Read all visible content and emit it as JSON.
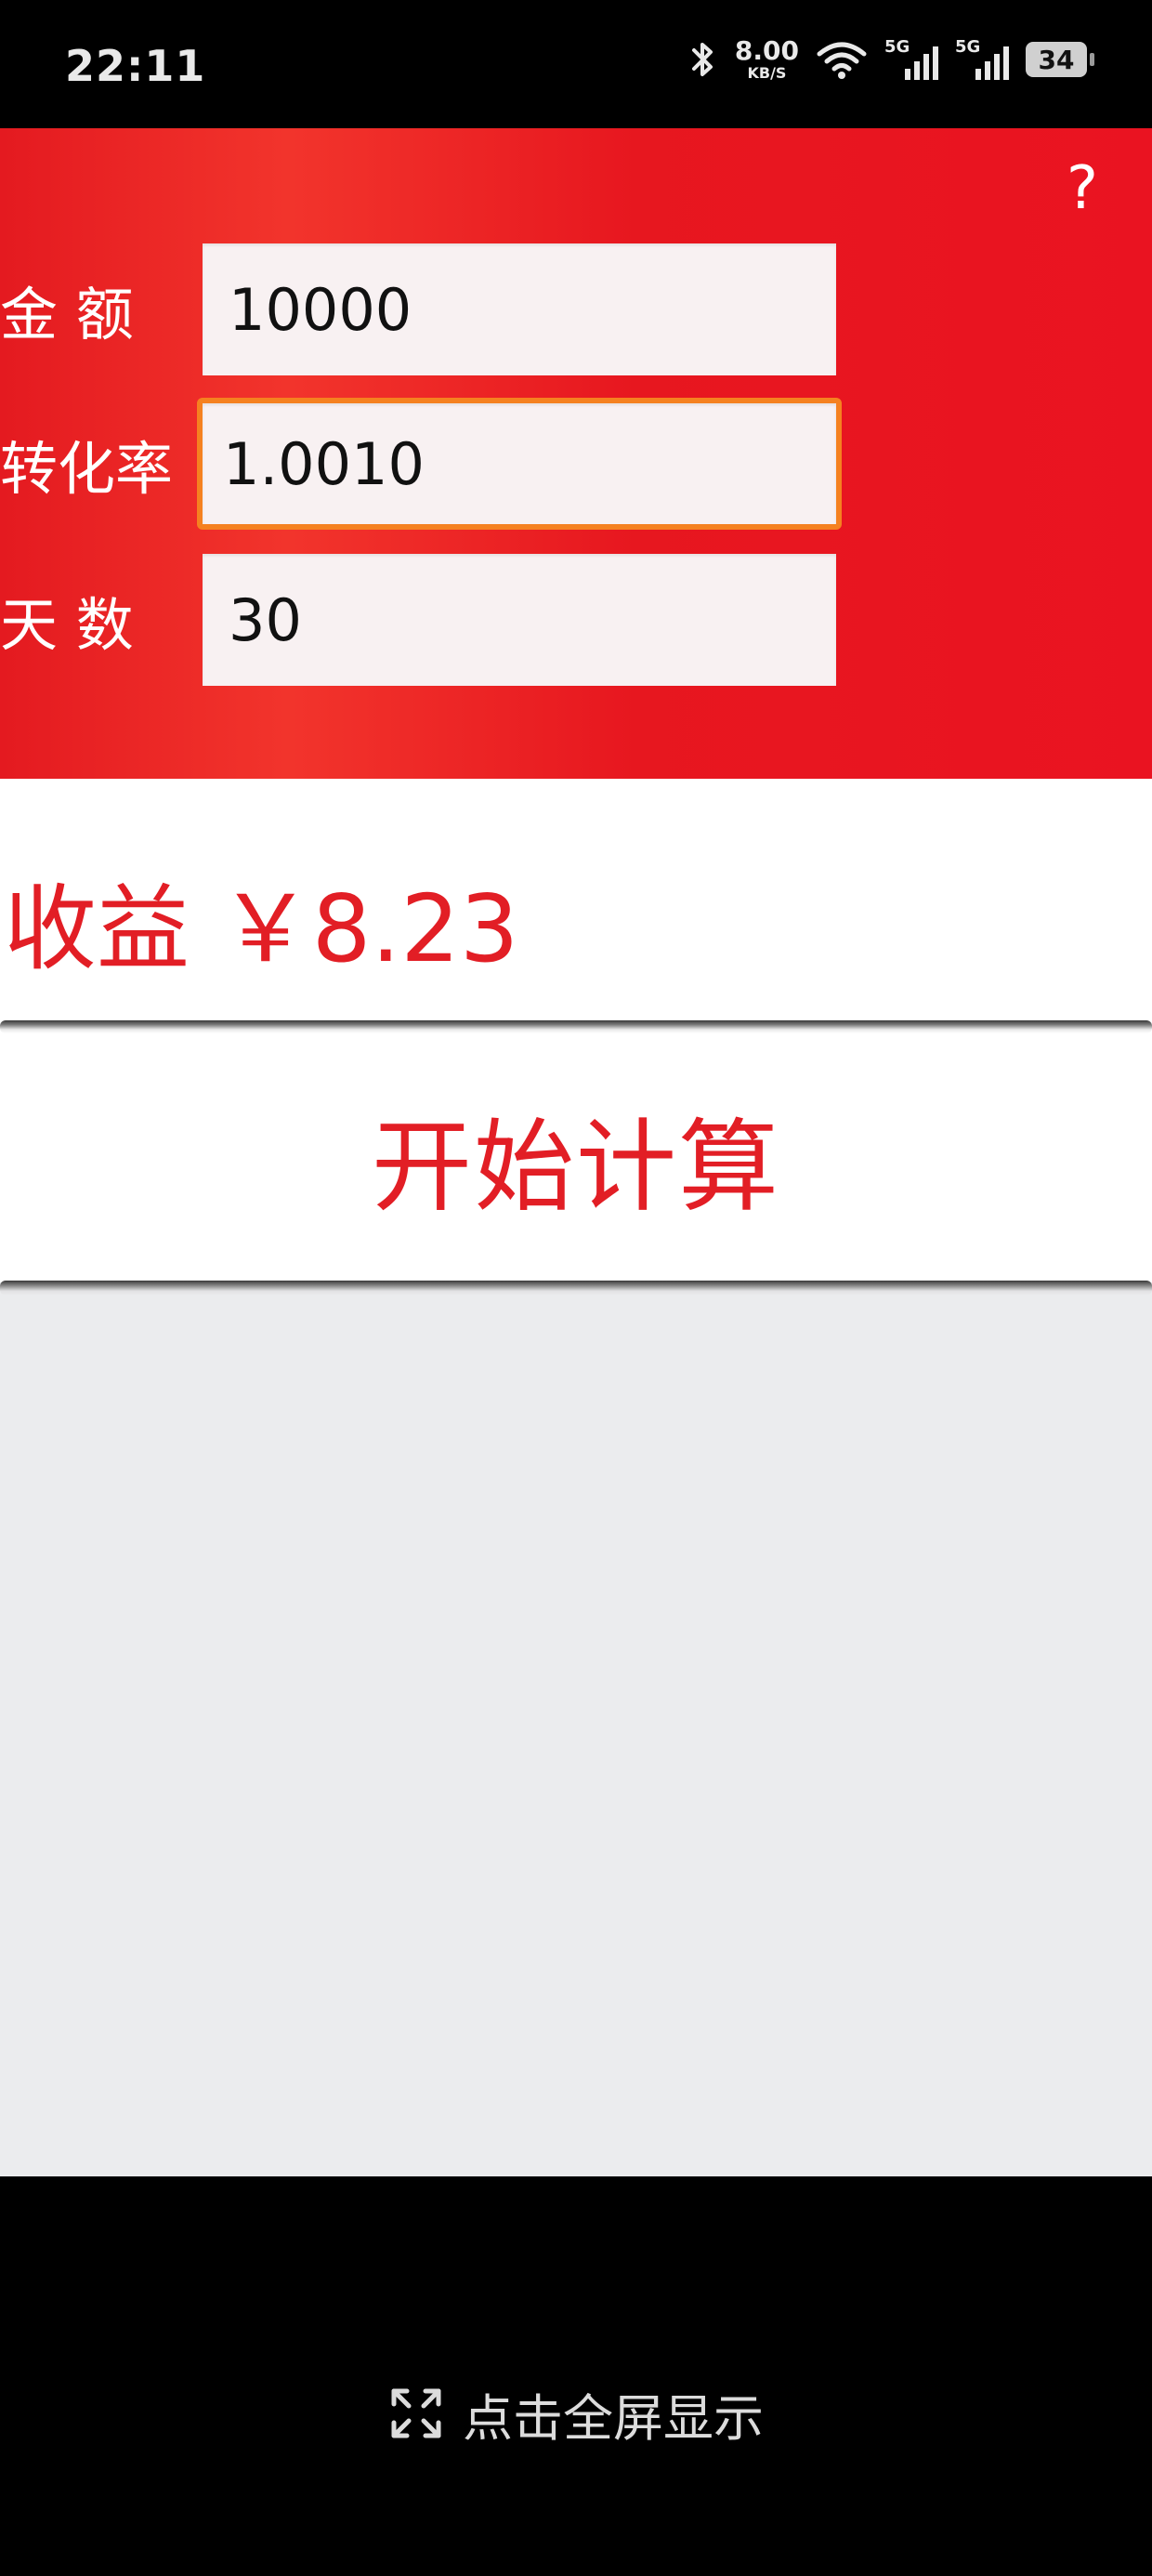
{
  "status_bar": {
    "time": "22:11",
    "net_speed_value": "8.00",
    "net_speed_unit": "KB/S",
    "sim1_type": "5G",
    "sim2_type": "5G",
    "battery_level": "34",
    "icons": [
      "bluetooth-icon",
      "wifi-icon",
      "signal-icon",
      "battery-icon"
    ]
  },
  "header": {
    "help_label": "?"
  },
  "form": {
    "amount_label": "金 额",
    "amount_value": "10000",
    "rate_label": "转化率",
    "rate_value": "1.0010",
    "days_label": "天 数",
    "days_value": "30"
  },
  "result": {
    "text": "收益 ￥8.23"
  },
  "actions": {
    "calculate_label": "开始计算"
  },
  "bottom": {
    "fullscreen_label": "点击全屏显示"
  },
  "colors": {
    "brand_red": "#e41a20",
    "accent_red_text": "#e21e25",
    "focus_orange": "#f58120",
    "content_bg": "#ebecee"
  }
}
